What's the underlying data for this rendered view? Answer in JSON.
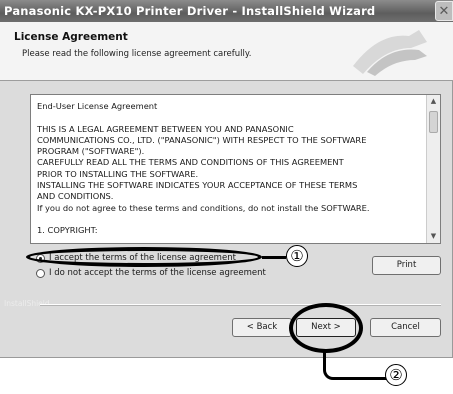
{
  "window": {
    "title": "Panasonic KX-PX10 Printer Driver - InstallShield Wizard",
    "close_glyph": "✕"
  },
  "header": {
    "title": "License Agreement",
    "subtitle": "Please read the following license agreement carefully."
  },
  "license": {
    "lines": [
      "End-User License Agreement",
      "",
      "THIS IS A LEGAL AGREEMENT BETWEEN YOU AND PANASONIC",
      "COMMUNICATIONS CO., LTD. (\"PANASONIC\") WITH RESPECT TO THE SOFTWARE",
      "PROGRAM (\"SOFTWARE\").",
      "CAREFULLY READ ALL THE TERMS AND CONDITIONS OF THIS AGREEMENT",
      "PRIOR TO INSTALLING THE SOFTWARE.",
      "INSTALLING THE SOFTWARE INDICATES YOUR ACCEPTANCE OF THESE TERMS",
      "AND CONDITIONS.",
      "If you do not agree to these terms and conditions, do not install the SOFTWARE.",
      "",
      "1.   COPYRIGHT:"
    ],
    "scroll_up": "▲",
    "scroll_down": "▼"
  },
  "options": {
    "accept_label": "I accept the terms of the license agreement",
    "decline_label": "I do not accept the terms of the license agreement",
    "selected": "accept"
  },
  "buttons": {
    "print": "Print",
    "back": "< Back",
    "next": "Next >",
    "cancel": "Cancel"
  },
  "footer": {
    "installshield": "InstallShield"
  },
  "callouts": {
    "one": "①",
    "two": "②"
  }
}
